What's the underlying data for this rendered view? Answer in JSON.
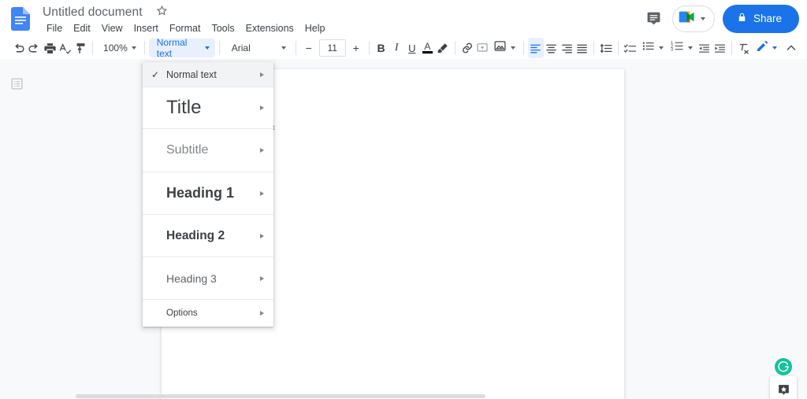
{
  "header": {
    "logo_icon": "google-docs-logo",
    "doc_title": "Untitled document",
    "star_icon": "star-outline-icon",
    "menus": [
      "File",
      "Edit",
      "View",
      "Insert",
      "Format",
      "Tools",
      "Extensions",
      "Help"
    ],
    "comment_icon": "comment-history-icon",
    "meet_icon": "google-meet-icon",
    "meet_caret_icon": "chevron-down-icon",
    "share_lock_icon": "lock-icon",
    "share_label": "Share",
    "share_color": "#1a73e8"
  },
  "toolbar": {
    "undo_icon": "undo-icon",
    "redo_icon": "redo-icon",
    "print_icon": "print-icon",
    "spellcheck_icon": "spellcheck-icon",
    "paint_format_icon": "paint-format-icon",
    "zoom_value": "100%",
    "zoom_caret_icon": "chevron-down-icon",
    "style_value": "Normal text",
    "style_caret_icon": "chevron-down-icon",
    "style_active_color": "#1a73e8",
    "font_value": "Arial",
    "font_caret_icon": "chevron-down-icon",
    "font_size_decrease": "−",
    "font_size_value": "11",
    "font_size_increase": "+",
    "bold_label": "B",
    "italic_label": "I",
    "underline_label": "U",
    "text_color_label": "A",
    "highlight_icon": "highlight-pen-icon",
    "link_icon": "insert-link-icon",
    "comment_icon": "add-comment-icon",
    "image_icon": "insert-image-icon",
    "image_caret_icon": "chevron-down-icon",
    "align_left_icon": "align-left-icon",
    "align_center_icon": "align-center-icon",
    "align_right_icon": "align-right-icon",
    "align_justify_icon": "align-justify-icon",
    "line_spacing_icon": "line-spacing-icon",
    "checklist_icon": "checklist-icon",
    "bulleted_list_icon": "bulleted-list-icon",
    "bulleted_caret_icon": "chevron-down-icon",
    "numbered_list_icon": "numbered-list-icon",
    "numbered_caret_icon": "chevron-down-icon",
    "decrease_indent_icon": "decrease-indent-icon",
    "increase_indent_icon": "increase-indent-icon",
    "clear_formatting_icon": "clear-formatting-icon",
    "edit_mode_icon": "edit-pencil-icon",
    "edit_mode_caret_icon": "chevron-down-icon",
    "collapse_icon": "chevron-up-icon"
  },
  "style_menu": {
    "items": [
      {
        "label": "Normal text",
        "checked": true,
        "arrow_icon": "submenu-arrow-icon",
        "highlighted": true
      },
      {
        "label": "Title",
        "checked": false,
        "arrow_icon": "submenu-arrow-icon",
        "highlighted": false
      },
      {
        "label": "Subtitle",
        "checked": false,
        "arrow_icon": "submenu-arrow-icon",
        "highlighted": false
      },
      {
        "label": "Heading 1",
        "checked": false,
        "arrow_icon": "submenu-arrow-icon",
        "highlighted": false
      },
      {
        "label": "Heading 2",
        "checked": false,
        "arrow_icon": "submenu-arrow-icon",
        "highlighted": false
      },
      {
        "label": "Heading 3",
        "checked": false,
        "arrow_icon": "submenu-arrow-icon",
        "highlighted": false
      },
      {
        "label": "Options",
        "checked": false,
        "arrow_icon": "submenu-arrow-icon",
        "highlighted": false
      }
    ],
    "check_glyph": "✓"
  },
  "document": {
    "outline_toggle_icon": "document-outline-icon",
    "visible_text": "rt"
  },
  "floating": {
    "grammarly_icon": "grammarly-icon",
    "explore_icon": "explore-icon"
  }
}
